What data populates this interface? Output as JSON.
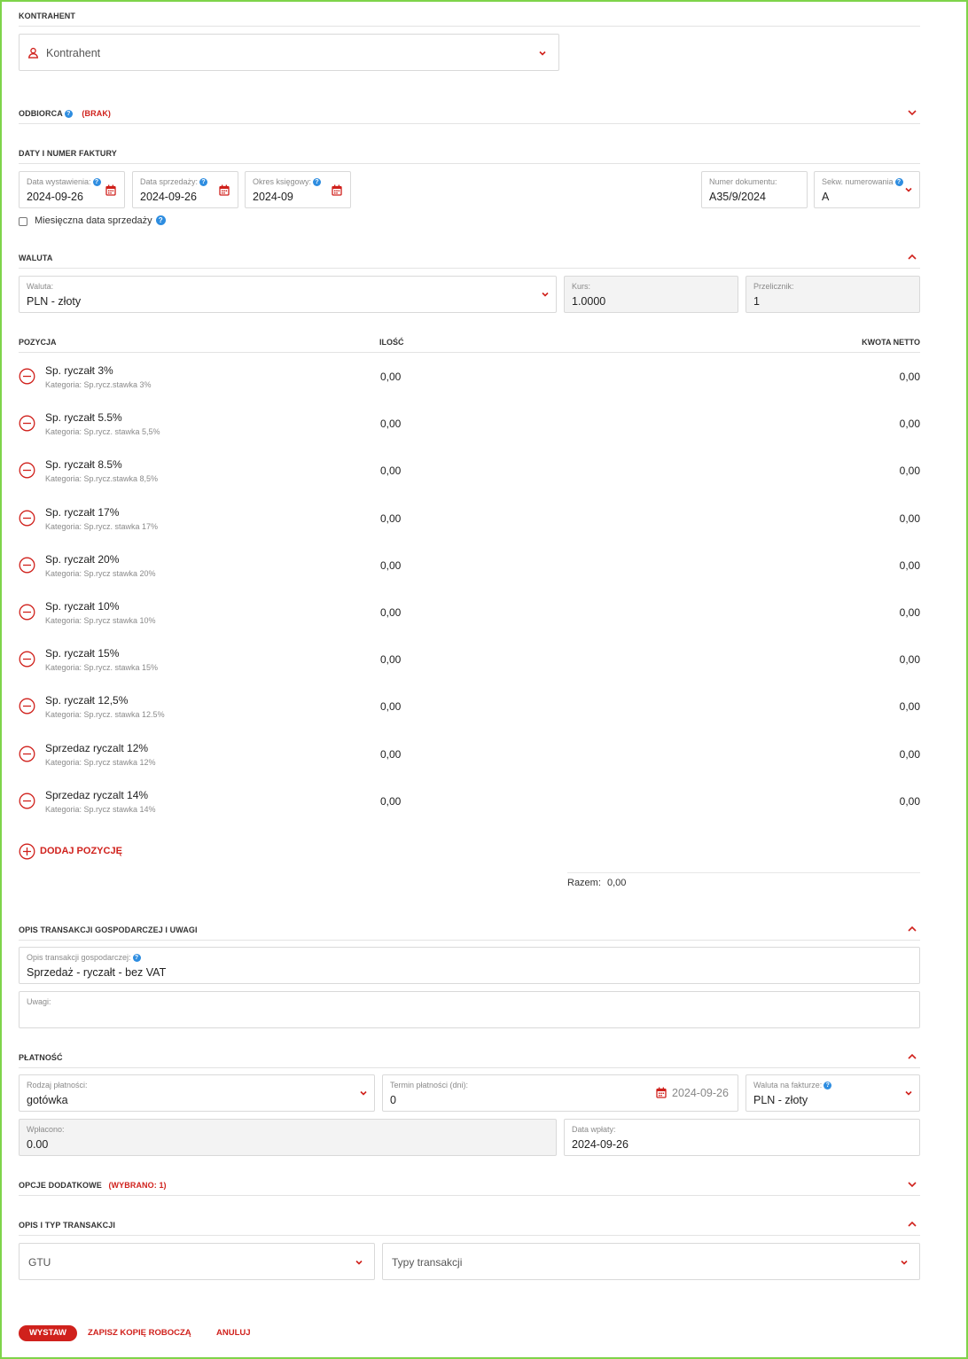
{
  "contractor": {
    "section_title": "KONTRAHENT",
    "placeholder": "Kontrahent"
  },
  "recipient": {
    "section_title": "ODBIORCA",
    "status": "(BRAK)"
  },
  "dates": {
    "section_title": "DATY I NUMER FAKTURY",
    "issue_date_label": "Data wystawienia:",
    "issue_date": "2024-09-26",
    "sale_date_label": "Data sprzedaży:",
    "sale_date": "2024-09-26",
    "period_label": "Okres księgowy:",
    "period": "2024-09",
    "doc_number_label": "Numer dokumentu:",
    "doc_number": "A35/9/2024",
    "seq_label": "Sekw. numerowania",
    "seq_value": "A",
    "monthly_label": "Miesięczna data sprzedaży"
  },
  "currency": {
    "section_title": "WALUTA",
    "currency_label": "Waluta:",
    "currency_value": "PLN - złoty",
    "rate_label": "Kurs:",
    "rate_value": "1.0000",
    "factor_label": "Przelicznik:",
    "factor_value": "1"
  },
  "items": {
    "col_position": "POZYCJA",
    "col_qty": "ILOŚĆ",
    "col_amount": "KWOTA NETTO",
    "rows": [
      {
        "name": "Sp. ryczałt 3%",
        "category": "Kategoria: Sp.rycz.stawka 3%",
        "qty": "0,00",
        "amount": "0,00"
      },
      {
        "name": "Sp. ryczałt 5.5%",
        "category": "Kategoria: Sp.rycz. stawka 5,5%",
        "qty": "0,00",
        "amount": "0,00"
      },
      {
        "name": "Sp. ryczałt 8.5%",
        "category": "Kategoria: Sp.rycz.stawka 8,5%",
        "qty": "0,00",
        "amount": "0,00"
      },
      {
        "name": "Sp. ryczałt 17%",
        "category": "Kategoria: Sp.rycz. stawka 17%",
        "qty": "0,00",
        "amount": "0,00"
      },
      {
        "name": "Sp. ryczałt 20%",
        "category": "Kategoria: Sp.rycz stawka 20%",
        "qty": "0,00",
        "amount": "0,00"
      },
      {
        "name": "Sp. ryczałt 10%",
        "category": "Kategoria: Sp.rycz stawka 10%",
        "qty": "0,00",
        "amount": "0,00"
      },
      {
        "name": "Sp. ryczałt 15%",
        "category": "Kategoria: Sp.rycz. stawka 15%",
        "qty": "0,00",
        "amount": "0,00"
      },
      {
        "name": "Sp. ryczałt 12,5%",
        "category": "Kategoria: Sp.rycz. stawka 12.5%",
        "qty": "0,00",
        "amount": "0,00"
      },
      {
        "name": "Sprzedaz ryczalt 12%",
        "category": "Kategoria: Sp.rycz stawka 12%",
        "qty": "0,00",
        "amount": "0,00"
      },
      {
        "name": "Sprzedaz ryczalt 14%",
        "category": "Kategoria: Sp.rycz stawka 14%",
        "qty": "0,00",
        "amount": "0,00"
      }
    ],
    "add_label": "DODAJ POZYCJĘ",
    "total_label": "Razem:",
    "total_value": "0,00"
  },
  "description": {
    "section_title": "OPIS TRANSAKCJI GOSPODARCZEJ I UWAGI",
    "desc_label": "Opis transakcji gospodarczej:",
    "desc_value": "Sprzedaż - ryczałt - bez VAT",
    "notes_label": "Uwagi:"
  },
  "payment": {
    "section_title": "PŁATNOŚĆ",
    "type_label": "Rodzaj płatności:",
    "type_value": "gotówka",
    "term_label": "Termin płatności (dni):",
    "term_value": "0",
    "term_date": "2024-09-26",
    "inv_currency_label": "Waluta na fakturze:",
    "inv_currency_value": "PLN - złoty",
    "paid_label": "Wpłacono:",
    "paid_value": "0.00",
    "paid_date_label": "Data wpłaty:",
    "paid_date_value": "2024-09-26"
  },
  "options": {
    "section_title": "OPCJE DODATKOWE",
    "status": "(WYBRANO: 1)"
  },
  "transaction": {
    "section_title": "OPIS I TYP TRANSAKCJI",
    "gtu_placeholder": "GTU",
    "types_placeholder": "Typy transakcji"
  },
  "actions": {
    "issue": "WYSTAW",
    "save_draft": "ZAPISZ KOPIĘ ROBOCZĄ",
    "cancel": "ANULUJ"
  },
  "colors": {
    "accent": "#d0211c",
    "help": "#2e8de0",
    "frame": "#7ed44a"
  }
}
